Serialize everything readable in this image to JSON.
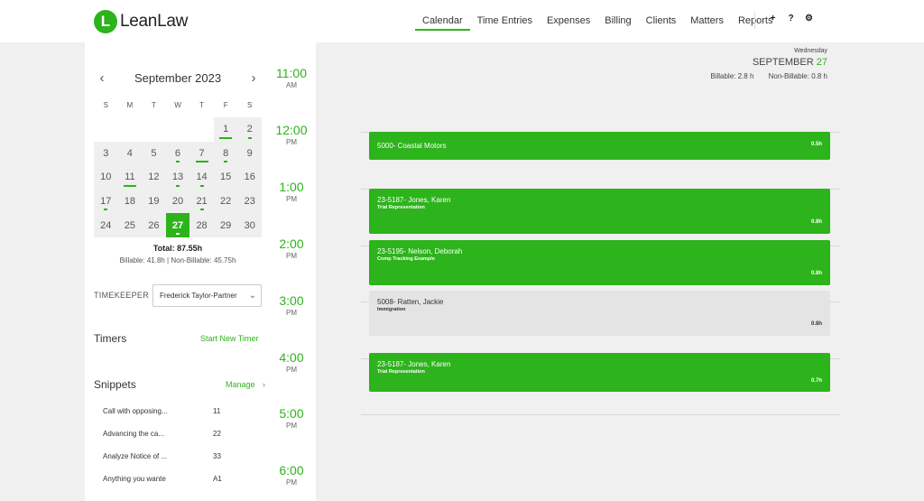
{
  "app": {
    "logo_letter": "L",
    "logo_text": "LeanLaw"
  },
  "nav": {
    "items": [
      "Calendar",
      "Time Entries",
      "Expenses",
      "Billing",
      "Clients",
      "Matters",
      "Reports"
    ],
    "active": "Calendar",
    "icons": [
      "plus-icon",
      "help-icon",
      "gear-icon"
    ],
    "icon_glyphs": [
      "+",
      "?",
      "⚙"
    ]
  },
  "calendar": {
    "month_label": "September 2023",
    "prev_glyph": "‹",
    "next_glyph": "›",
    "weekdays": [
      "S",
      "M",
      "T",
      "W",
      "T",
      "F",
      "S"
    ],
    "weeks": [
      [
        "",
        "",
        "",
        "",
        "",
        "1",
        "2"
      ],
      [
        "3",
        "4",
        "5",
        "6",
        "7",
        "8",
        "9"
      ],
      [
        "10",
        "11",
        "12",
        "13",
        "14",
        "15",
        "16"
      ],
      [
        "17",
        "18",
        "19",
        "20",
        "21",
        "22",
        "23"
      ],
      [
        "24",
        "25",
        "26",
        "27",
        "28",
        "29",
        "30"
      ]
    ],
    "selected_day": "27",
    "tinted_days": [
      "1",
      "2",
      "3",
      "4",
      "5",
      "6",
      "7",
      "8",
      "9",
      "10",
      "11",
      "12",
      "13",
      "14",
      "15",
      "16",
      "17",
      "18",
      "19",
      "20",
      "21",
      "22",
      "23",
      "24",
      "25",
      "26",
      "27",
      "28",
      "29",
      "30"
    ],
    "underlined_long": [
      "1",
      "7",
      "11"
    ],
    "underlined_short": [
      "2",
      "6",
      "8",
      "13",
      "14",
      "17",
      "21",
      "27"
    ],
    "total": "Total: 87.55h",
    "subtotal": "Billable: 41.8h | Non-Billable: 45.75h"
  },
  "timekeeper": {
    "label": "TIMEKEEPER",
    "value": "Frederick Taylor-Partner",
    "chevron": "⌄"
  },
  "timers": {
    "title": "Timers",
    "link": "Start New Timer"
  },
  "snippets": {
    "title": "Snippets",
    "link": "Manage",
    "link_arrow": "›",
    "items": [
      {
        "text": "Call with opposing...",
        "code": "11"
      },
      {
        "text": "Advancing the ca...",
        "code": "22"
      },
      {
        "text": "Analyze Notice of ...",
        "code": "33"
      },
      {
        "text": "Anything you wante",
        "code": "A1"
      }
    ]
  },
  "times": [
    {
      "hour": "11:00",
      "ampm": "AM"
    },
    {
      "hour": "12:00",
      "ampm": "PM"
    },
    {
      "hour": "1:00",
      "ampm": "PM"
    },
    {
      "hour": "2:00",
      "ampm": "PM"
    },
    {
      "hour": "3:00",
      "ampm": "PM"
    },
    {
      "hour": "4:00",
      "ampm": "PM"
    },
    {
      "hour": "5:00",
      "ampm": "PM"
    },
    {
      "hour": "6:00",
      "ampm": "PM"
    }
  ],
  "day_header": {
    "weekday": "Wednesday",
    "month": "SEPTEMBER",
    "day": "27",
    "billable": "Billable: 2.8 h",
    "non_billable": "Non-Billable: 0.8 h"
  },
  "events": [
    {
      "title": "5000- Coastal Motors",
      "desc": "",
      "hours": "0.5h",
      "color": "green"
    },
    {
      "title": "23-5187- Jones, Karen",
      "desc": "Trial Representation",
      "hours": "0.8h",
      "color": "green"
    },
    {
      "title": "23-5195- Nelson, Deborah",
      "desc": "Comp Tracking Example",
      "hours": "0.8h",
      "color": "green"
    },
    {
      "title": "5008- Ratten, Jackie",
      "desc": "Immigration",
      "hours": "0.8h",
      "color": "grey"
    },
    {
      "title": "23-5187- Jones, Karen",
      "desc": "Trial Representation",
      "hours": "0.7h",
      "color": "green"
    }
  ],
  "colors": {
    "accent": "#2db31b",
    "event_green": "#2db31b",
    "event_grey": "#e4e4e4"
  }
}
